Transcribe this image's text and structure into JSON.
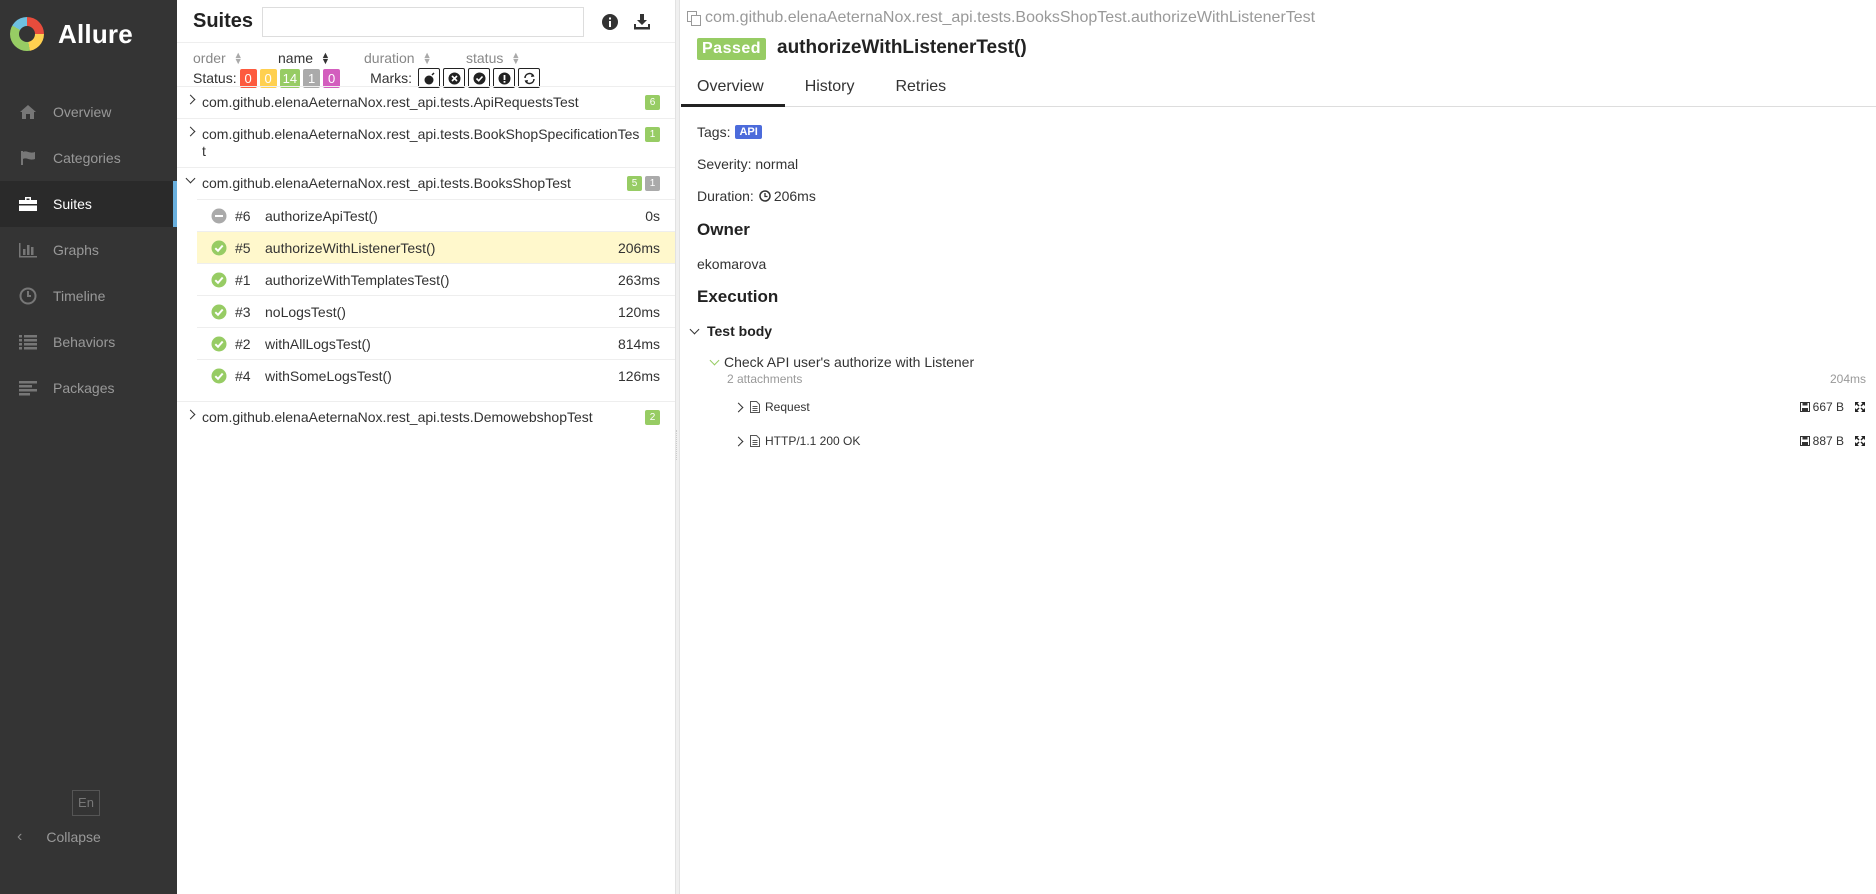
{
  "app": {
    "name": "Allure"
  },
  "sidebar": {
    "items": [
      {
        "label": "Overview",
        "icon": "home-icon"
      },
      {
        "label": "Categories",
        "icon": "flag-icon"
      },
      {
        "label": "Suites",
        "icon": "briefcase-icon",
        "active": true
      },
      {
        "label": "Graphs",
        "icon": "bar-chart-icon"
      },
      {
        "label": "Timeline",
        "icon": "clock-icon"
      },
      {
        "label": "Behaviors",
        "icon": "list-icon"
      },
      {
        "label": "Packages",
        "icon": "align-left-icon"
      }
    ],
    "language": "En",
    "collapse": "Collapse"
  },
  "tree": {
    "title": "Suites",
    "search_placeholder": "",
    "sort": {
      "order": "order",
      "name": "name",
      "duration": "duration",
      "status": "status"
    },
    "status_label": "Status:",
    "status_counts": {
      "failed": "0",
      "broken": "0",
      "passed": "14",
      "skipped": "1",
      "unknown": "0"
    },
    "marks_label": "Marks:",
    "groups": [
      {
        "name": "com.github.elenaAeternaNox.rest_api.tests.ApiRequestsTest",
        "passed": "6"
      },
      {
        "name": "com.github.elenaAeternaNox.rest_api.tests.BookShopSpecificationTest",
        "passed": "1"
      },
      {
        "name": "com.github.elenaAeternaNox.rest_api.tests.BooksShopTest",
        "passed": "5",
        "skipped": "1"
      },
      {
        "name": "com.github.elenaAeternaNox.rest_api.tests.DemowebshopTest",
        "passed": "2"
      }
    ],
    "tests": [
      {
        "num": "#6",
        "name": "authorizeApiTest()",
        "duration": "0s",
        "status": "skipped"
      },
      {
        "num": "#5",
        "name": "authorizeWithListenerTest()",
        "duration": "206ms",
        "status": "passed"
      },
      {
        "num": "#1",
        "name": "authorizeWithTemplatesTest()",
        "duration": "263ms",
        "status": "passed"
      },
      {
        "num": "#3",
        "name": "noLogsTest()",
        "duration": "120ms",
        "status": "passed"
      },
      {
        "num": "#2",
        "name": "withAllLogsTest()",
        "duration": "814ms",
        "status": "passed"
      },
      {
        "num": "#4",
        "name": "withSomeLogsTest()",
        "duration": "126ms",
        "status": "passed"
      }
    ]
  },
  "detail": {
    "path": "com.github.elenaAeternaNox.rest_api.tests.BooksShopTest.authorizeWithListenerTest",
    "status": "Passed",
    "title": "authorizeWithListenerTest()",
    "tabs": [
      "Overview",
      "History",
      "Retries"
    ],
    "tags_label": "Tags:",
    "tag": "API",
    "severity": "Severity: normal",
    "duration_label": "Duration:",
    "duration": "206ms",
    "owner_heading": "Owner",
    "owner": "ekomarova",
    "execution_heading": "Execution",
    "test_body": "Test body",
    "step": "Check API user's authorize with Listener",
    "attachments_count": "2 attachments",
    "step_duration": "204ms",
    "attachments": [
      {
        "name": "Request",
        "size": "667 B"
      },
      {
        "name": "HTTP/1.1 200 OK",
        "size": "887 B"
      }
    ]
  },
  "colors": {
    "sidebar_bg": "#343434",
    "passed": "#97cc64",
    "failed": "#fd5a3e",
    "broken": "#ffd050",
    "skipped": "#aaaaaa",
    "unknown": "#d35ebe",
    "tag": "#4c6bdb",
    "selected_row": "#fff8cc"
  }
}
